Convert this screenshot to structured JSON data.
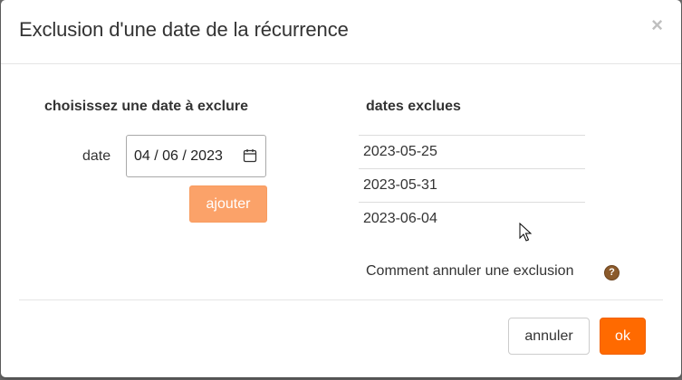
{
  "dialog": {
    "title": "Exclusion d'une date de la récurrence",
    "close_label": "×"
  },
  "left": {
    "heading": "choisissez une date à exclure",
    "date_label": "date",
    "date_value": "04 / 06 / 2023",
    "add_button": "ajouter"
  },
  "right": {
    "heading": "dates exclues",
    "excluded_dates": [
      "2023-05-25",
      "2023-05-31",
      "2023-06-04"
    ],
    "help_text": "Comment annuler une exclusion",
    "help_icon": "question-icon"
  },
  "footer": {
    "cancel_button": "annuler",
    "ok_button": "ok"
  },
  "colors": {
    "accent": "#ff6a00",
    "accent_light": "#fba269",
    "help_icon": "#8b5a2b"
  }
}
